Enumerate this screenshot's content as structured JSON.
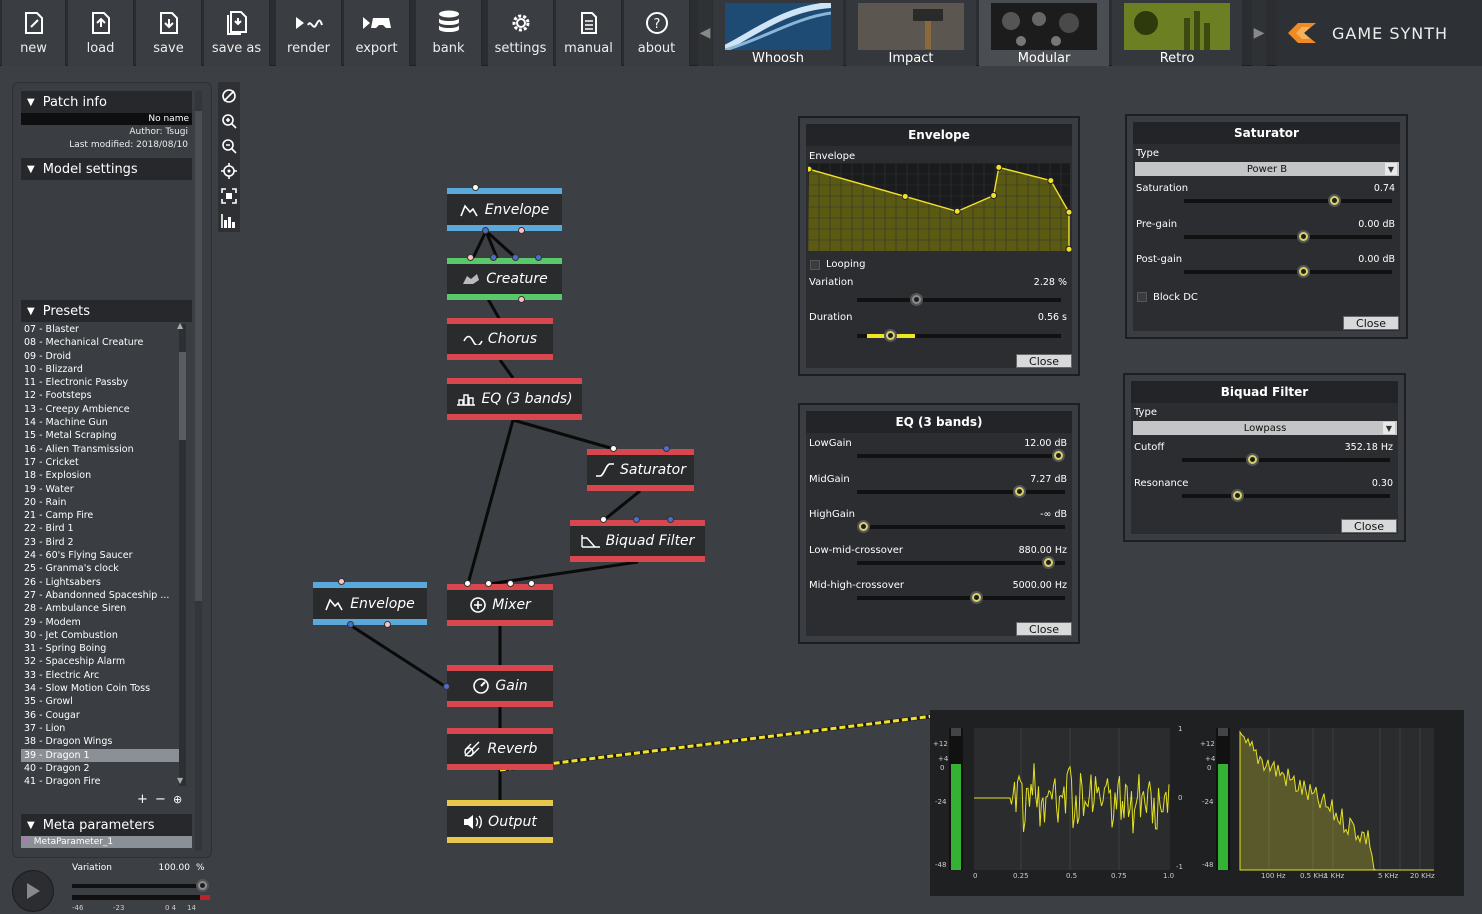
{
  "toolbar": {
    "buttons": [
      {
        "label": "new",
        "icon": "new-file-icon"
      },
      {
        "label": "load",
        "icon": "load-icon"
      },
      {
        "label": "save",
        "icon": "save-icon"
      },
      {
        "label": "save as",
        "icon": "save-as-icon"
      },
      {
        "label": "render",
        "icon": "render-icon"
      },
      {
        "label": "export",
        "icon": "export-icon"
      },
      {
        "label": "bank",
        "icon": "bank-icon"
      },
      {
        "label": "settings",
        "icon": "gear-icon"
      },
      {
        "label": "manual",
        "icon": "manual-icon"
      },
      {
        "label": "about",
        "icon": "help-icon"
      }
    ],
    "models": [
      {
        "label": "Whoosh",
        "active": false
      },
      {
        "label": "Impact",
        "active": false
      },
      {
        "label": "Modular",
        "active": true
      },
      {
        "label": "Retro",
        "active": false
      }
    ],
    "logo_text": "GAME SYNTH",
    "logo_color": "#f08a24"
  },
  "left_panel": {
    "patch_info": {
      "heading": "Patch info",
      "name": "No name",
      "author": "Author: Tsugi",
      "last_modified": "Last modified: 2018/08/10"
    },
    "model_settings": {
      "heading": "Model settings"
    },
    "presets": {
      "heading": "Presets",
      "items": [
        "07 - Blaster",
        "08 - Mechanical Creature",
        "09 - Droid",
        "10 - Blizzard",
        "11 - Electronic Passby",
        "12 - Footsteps",
        "13 - Creepy Ambience",
        "14 - Machine Gun",
        "15 - Metal Scraping",
        "16 - Alien Transmission",
        "17 - Cricket",
        "18 - Explosion",
        "19 - Water",
        "20 - Rain",
        "21 - Camp Fire",
        "22 - Bird 1",
        "23 - Bird 2",
        "24 - 60's Flying Saucer",
        "25 - Granma's clock",
        "26 - Lightsabers",
        "27 - Abandonned Spaceship ...",
        "28 - Ambulance Siren",
        "29 - Modem",
        "30 - Jet Combustion",
        "31 - Spring Boing",
        "32 - Spaceship Alarm",
        "33 - Electric Arc",
        "34 - Slow Motion Coin Toss",
        "35 - Growl",
        "36 - Cougar",
        "37 - Lion",
        "38 - Dragon Wings",
        "39 - Dragon 1",
        "40 - Dragon 2",
        "41 - Dragon Fire"
      ],
      "selected_index": 32,
      "actions": [
        "+",
        "−",
        "⊕"
      ]
    },
    "meta_parameters": {
      "heading": "Meta parameters",
      "items": [
        "MetaParameter_1"
      ]
    }
  },
  "transport": {
    "variation_label": "Variation",
    "variation_value": "100.00",
    "variation_unit": "%",
    "meter_ticks": [
      "-46",
      "-23",
      "0 4",
      "14"
    ]
  },
  "nodes": {
    "envelope_1": "Envelope",
    "creature": "Creature",
    "chorus": "Chorus",
    "eq": "EQ (3 bands)",
    "saturator": "Saturator",
    "biquad": "Biquad Filter",
    "envelope_2": "Envelope",
    "mixer": "Mixer",
    "gain": "Gain",
    "reverb": "Reverb",
    "output": "Output"
  },
  "envelope_dialog": {
    "title": "Envelope",
    "graph_label": "Envelope",
    "looping_label": "Looping",
    "variation_label": "Variation",
    "variation_value": "2.28 %",
    "duration_label": "Duration",
    "duration_value": "0.56 s",
    "close_label": "Close",
    "points": [
      [
        0.0,
        0.07
      ],
      [
        0.37,
        0.38
      ],
      [
        0.57,
        0.55
      ],
      [
        0.71,
        0.37
      ],
      [
        0.73,
        0.05
      ],
      [
        0.93,
        0.2
      ],
      [
        1.0,
        0.56
      ],
      [
        1.05,
        0.98
      ]
    ]
  },
  "eq_dialog": {
    "title": "EQ (3 bands)",
    "params": [
      {
        "label": "LowGain",
        "value": "12.00 dB",
        "pos": 1.0
      },
      {
        "label": "MidGain",
        "value": "7.27 dB",
        "pos": 0.8
      },
      {
        "label": "HighGain",
        "value": "-∞ dB",
        "pos": 0.0
      },
      {
        "label": "Low-mid-crossover",
        "value": "880.00 Hz",
        "pos": 0.95
      },
      {
        "label": "Mid-high-crossover",
        "value": "5000.00 Hz",
        "pos": 0.58
      }
    ],
    "close_label": "Close"
  },
  "saturator_dialog": {
    "title": "Saturator",
    "type_label": "Type",
    "type_value": "Power B",
    "params": [
      {
        "label": "Saturation",
        "value": "0.74",
        "pos": 0.74
      },
      {
        "label": "Pre-gain",
        "value": "0.00 dB",
        "pos": 0.58
      },
      {
        "label": "Post-gain",
        "value": "0.00 dB",
        "pos": 0.58
      }
    ],
    "block_dc_label": "Block DC",
    "close_label": "Close"
  },
  "biquad_dialog": {
    "title": "Biquad Filter",
    "type_label": "Type",
    "type_value": "Lowpass",
    "params": [
      {
        "label": "Cutoff",
        "value": "352.18 Hz",
        "pos": 0.33
      },
      {
        "label": "Resonance",
        "value": "0.30",
        "pos": 0.25
      }
    ],
    "close_label": "Close"
  },
  "analyzer": {
    "level_ticks": [
      "+12",
      "+4",
      "0",
      "-24",
      "-48"
    ],
    "wave_x_ticks": [
      "0",
      "0.25",
      "0.5",
      "0.75",
      "1.0"
    ],
    "wave_y_ticks": [
      "1",
      "0",
      "-1"
    ],
    "spec_x_ticks": [
      "100 Hz",
      "0.5 KHz",
      "1 KHz",
      "5 KHz",
      "20 KHz"
    ]
  }
}
